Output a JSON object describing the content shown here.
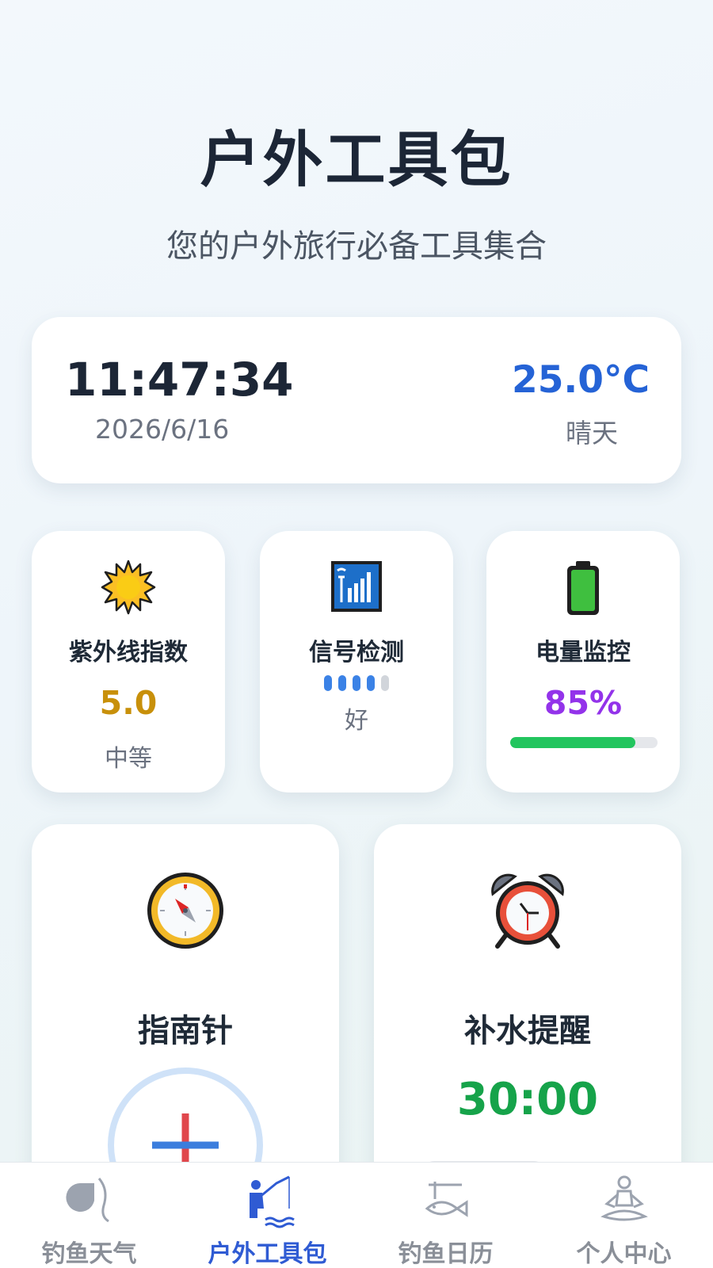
{
  "header": {
    "title": "户外工具包",
    "subtitle": "您的户外旅行必备工具集合"
  },
  "status": {
    "time": "11:47:34",
    "date": "2026/6/16",
    "temperature": "25.0°C",
    "weather": "晴天"
  },
  "tools": {
    "uv": {
      "icon": "sun-icon",
      "title": "紫外线指数",
      "value": "5.0",
      "level": "中等",
      "color": "#c8900a"
    },
    "signal": {
      "icon": "signal-bars-icon",
      "title": "信号检测",
      "bars_filled": 4,
      "bars_total": 5,
      "quality": "好"
    },
    "battery": {
      "icon": "battery-icon",
      "title": "电量监控",
      "value": "85%",
      "level_fraction": 0.85,
      "color": "#9333ea"
    }
  },
  "compass": {
    "icon": "compass-icon",
    "title": "指南针"
  },
  "hydration": {
    "icon": "alarm-clock-icon",
    "title": "补水提醒",
    "timer": "30:00",
    "color": "#16a34a"
  },
  "tabbar": {
    "active_color": "#2f5bd3",
    "items": [
      {
        "label": "钓鱼天气",
        "icon": "fishing-weather-icon"
      },
      {
        "label": "户外工具包",
        "icon": "angler-icon",
        "active": true
      },
      {
        "label": "钓鱼日历",
        "icon": "fish-calendar-icon"
      },
      {
        "label": "个人中心",
        "icon": "meditation-person-icon"
      }
    ]
  }
}
